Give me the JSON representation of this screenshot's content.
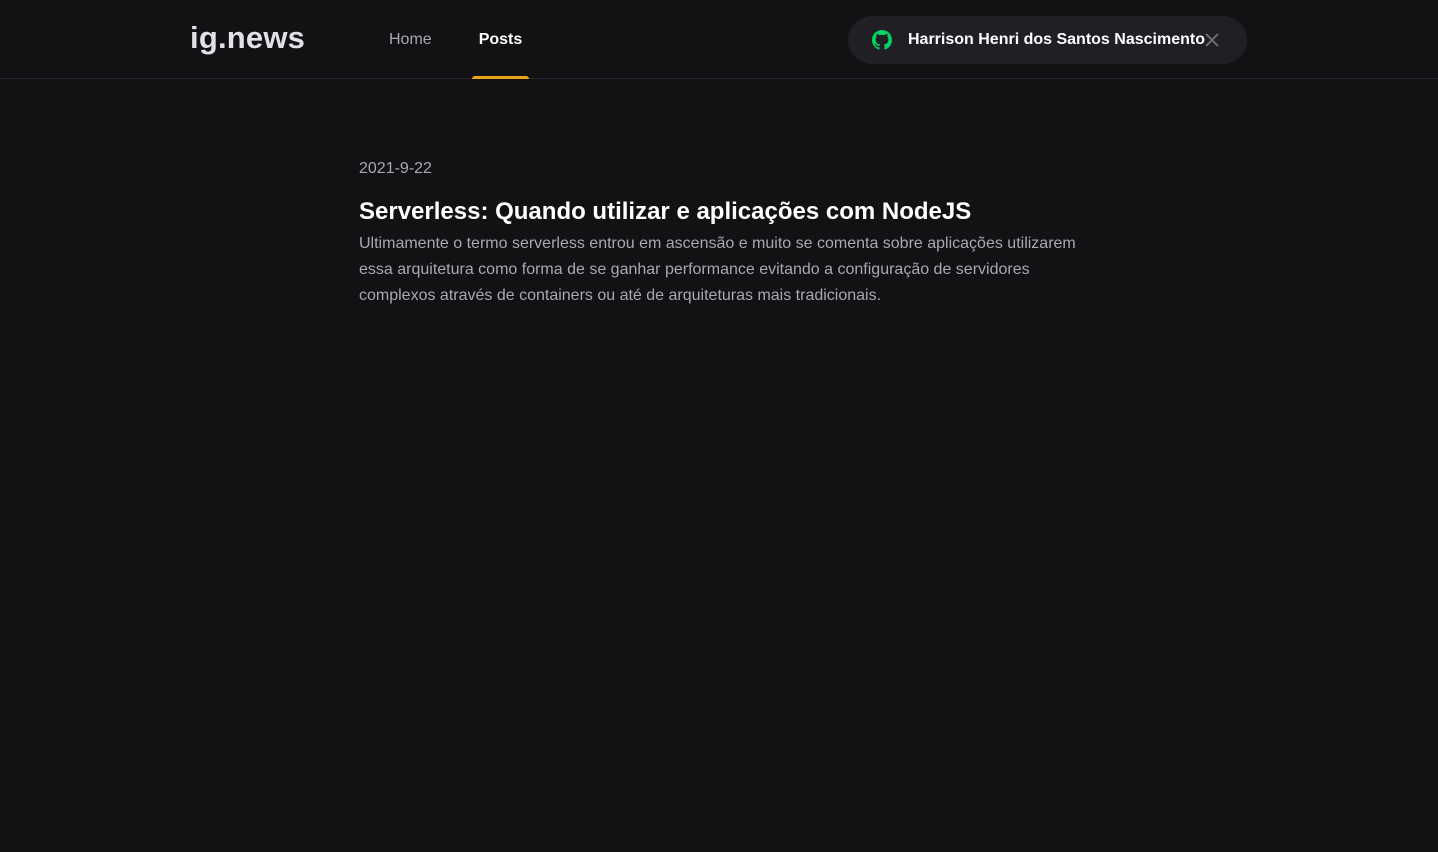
{
  "header": {
    "logo": "ig.news",
    "nav": {
      "home": "Home",
      "posts": "Posts",
      "active": "posts"
    },
    "signin": {
      "user_name": "Harrison Henri dos Santos Nascimento",
      "provider_icon": "github-icon",
      "close_icon": "close-icon"
    }
  },
  "posts": [
    {
      "date": "2021-9-22",
      "title": "Serverless: Quando utilizar e aplicações com NodeJS",
      "excerpt": "Ultimamente o termo serverless entrou em ascensão e muito se comenta sobre aplicações utilizarem essa arquitetura como forma de se ganhar performance evitando a configuração de servidores complexos através de containers ou até de arquiteturas mais tradicionais."
    }
  ],
  "colors": {
    "background": "#121214",
    "accent": "#eba417",
    "github_green": "#04d361",
    "text_muted": "#a8a8b3",
    "button_bg": "#202024"
  }
}
